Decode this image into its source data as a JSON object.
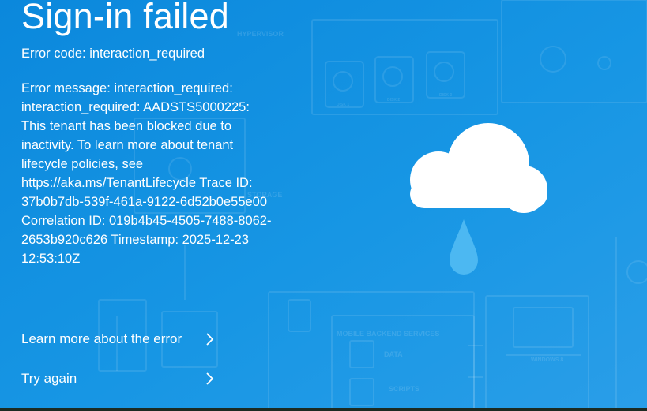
{
  "page": {
    "title": "Sign-in failed",
    "error_code": "Error code: interaction_required",
    "error_message": "Error message: interaction_required: interaction_required: AADSTS5000225: This tenant has been blocked due to inactivity. To learn more about tenant lifecycle policies, see https://aka.ms/TenantLifecycle Trace ID: 37b0b7db-539f-461a-9122-6d52b0e55e00 Correlation ID: 019b4b45-4505-7488-8062-2653b920c626 Timestamp: 2025-12-23 12:53:10Z"
  },
  "links": {
    "learn_more": "Learn more about the error",
    "try_again": "Try again"
  },
  "background_labels": {
    "hypervisor": "HYPERVISOR",
    "storage": "STORAGE",
    "mobile_backend": "MOBILE BACKEND SERVICES",
    "data": "DATA",
    "scripts": "SCRIPTS",
    "windows": "WINDOWS 8",
    "disk1": "DISK 1",
    "disk2": "DISK 2",
    "disk3": "DISK 3"
  },
  "icons": {
    "cloud": "cloud-rain-icon",
    "chevron": "chevron-right-icon"
  },
  "colors": {
    "background": "#0e8fe0",
    "background_light": "#3aa5ec",
    "text": "#ffffff",
    "raindrop": "#4cb8f2",
    "bottom_bar": "#1c2b22"
  }
}
